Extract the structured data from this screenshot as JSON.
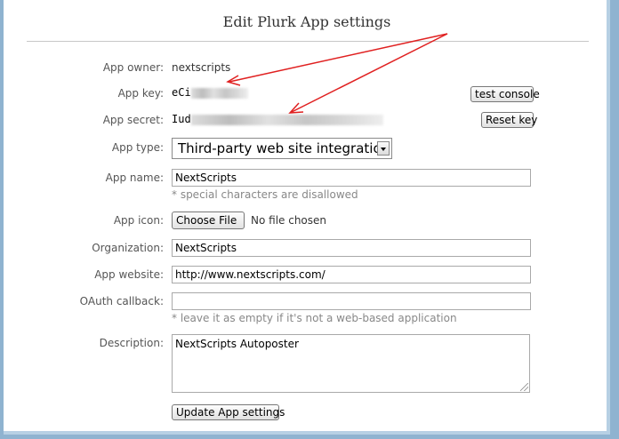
{
  "header": {
    "title": "Edit Plurk App settings"
  },
  "form": {
    "app_owner": {
      "label": "App owner:",
      "value": "nextscripts"
    },
    "app_key": {
      "label": "App key:",
      "value_visible": "eCi",
      "test_console_label": "test console"
    },
    "app_secret": {
      "label": "App secret:",
      "value_visible": "Iud",
      "reset_key_label": "Reset key"
    },
    "app_type": {
      "label": "App type:",
      "selected": "Third-party web site integration"
    },
    "app_name": {
      "label": "App name:",
      "value": "NextScripts",
      "hint": "* special characters are disallowed"
    },
    "app_icon": {
      "label": "App icon:",
      "choose_file_label": "Choose File",
      "no_file_text": "No file chosen"
    },
    "organization": {
      "label": "Organization:",
      "value": "NextScripts"
    },
    "app_website": {
      "label": "App website:",
      "value": "http://www.nextscripts.com/"
    },
    "oauth_callback": {
      "label": "OAuth callback:",
      "value": "",
      "hint": "* leave it as empty if it's not a web-based application"
    },
    "description": {
      "label": "Description:",
      "value": "NextScripts Autoposter"
    },
    "submit_label": "Update App settings"
  },
  "colors": {
    "annotation_arrow": "#e02020",
    "page_border": "#b7d0e4",
    "background": "#8fb3d0"
  }
}
